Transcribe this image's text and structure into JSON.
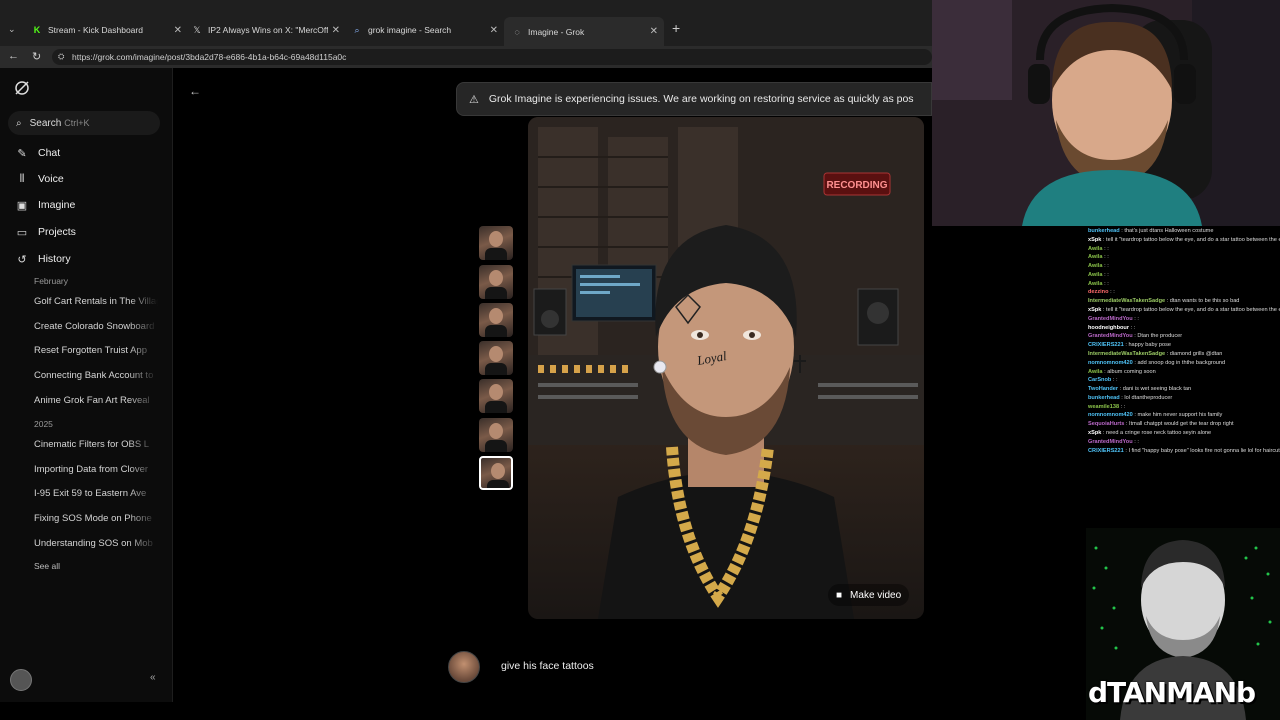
{
  "browser": {
    "tabs": [
      {
        "title": "Stream - Kick Dashboard",
        "icon": "kick-icon"
      },
      {
        "title": "IP2 Always Wins on X: \"MercOffDa",
        "icon": "x-logo-icon"
      },
      {
        "title": "grok imagine - Search",
        "icon": "search-icon"
      },
      {
        "title": "Imagine - Grok",
        "icon": "grok-icon"
      }
    ],
    "url": "https://grok.com/imagine/post/3bda2d78-e686-4b1a-b64c-69a48d115a0c"
  },
  "sidebar": {
    "search_label": "Search",
    "search_shortcut": "Ctrl+K",
    "nav": [
      {
        "label": "Chat",
        "icon": "chat-icon"
      },
      {
        "label": "Voice",
        "icon": "voice-icon"
      },
      {
        "label": "Imagine",
        "icon": "imagine-icon"
      },
      {
        "label": "Projects",
        "icon": "projects-icon"
      },
      {
        "label": "History",
        "icon": "history-icon"
      }
    ],
    "history_groups": [
      {
        "label": "February",
        "items": [
          "Golf Cart Rentals in The Villages",
          "Create Colorado Snowboard",
          "Reset Forgotten Truist App",
          "Connecting Bank Account to",
          "Anime Grok Fan Art Reveal"
        ]
      },
      {
        "label": "2025",
        "items": [
          "Cinematic Filters for OBS L",
          "Importing Data from Clover",
          "I-95 Exit 59 to Eastern Ave",
          "Fixing SOS Mode on Phone",
          "Understanding SOS on Mob"
        ]
      }
    ],
    "see_all": "See all"
  },
  "banner": {
    "text": "Grok Imagine is experiencing issues. We are working on restoring service as quickly as pos"
  },
  "image": {
    "sign_text": "RECORDING",
    "tattoo_text": "Loyal"
  },
  "make_video_label": "Make video",
  "prompt": {
    "text": "give his face tattoos"
  },
  "chat_messages": [
    {
      "user": "bunkerhead",
      "color": "#4fc3f7",
      "text": "that's just dtans Halloween costume"
    },
    {
      "user": "xSpk",
      "color": "#ffffff",
      "text": "tell it \"teardrop tattoo below the eye, and do a star tattoo between the eyebrows\""
    },
    {
      "user": "Awila",
      "color": "#8bc34a",
      "text": ":"
    },
    {
      "user": "Awila",
      "color": "#8bc34a",
      "text": ":"
    },
    {
      "user": "Awila",
      "color": "#8bc34a",
      "text": ":"
    },
    {
      "user": "Awila",
      "color": "#8bc34a",
      "text": ":"
    },
    {
      "user": "Awila",
      "color": "#8bc34a",
      "text": ":"
    },
    {
      "user": "dezzino",
      "color": "#ff6b6b",
      "text": ":"
    },
    {
      "user": "IntermediateWasTakenSadge",
      "color": "#9ccc65",
      "text": "dtan wants to be this so bad"
    },
    {
      "user": "xSpk",
      "color": "#ffffff",
      "text": "tell it \"teardrop tattoo below the eye, and do a star tattoo between the eyebrows\""
    },
    {
      "user": "GrantedMindYou",
      "color": "#ba68c8",
      "text": ":"
    },
    {
      "user": "hoodneighbour",
      "color": "#ffffff",
      "text": ":"
    },
    {
      "user": "GrantedMindYou",
      "color": "#ba68c8",
      "text": "Dtan the producer"
    },
    {
      "user": "CRIXIERS221",
      "color": "#4fc3f7",
      "text": "happy baby pose"
    },
    {
      "user": "IntermediateWasTakenSadge",
      "color": "#9ccc65",
      "text": "diamond grills @dtan"
    },
    {
      "user": "nomnomnom420",
      "color": "#4fc3f7",
      "text": "add snoop dog in ththe background"
    },
    {
      "user": "Awila",
      "color": "#8bc34a",
      "text": "album coming soon"
    },
    {
      "user": "CarSnob",
      "color": "#4fc3f7",
      "text": ":"
    },
    {
      "user": "TwoHander",
      "color": "#4fc3f7",
      "text": "dani is wet seeing black tan"
    },
    {
      "user": "bunkerhead",
      "color": "#4fc3f7",
      "text": "lol dtantheproducer"
    },
    {
      "user": "weamile138",
      "color": "#8bc34a",
      "text": ":"
    },
    {
      "user": "nomnomnom420",
      "color": "#4fc3f7",
      "text": "make him never support his family"
    },
    {
      "user": "SequoiaHurts",
      "color": "#ba68c8",
      "text": "Itmall chatgpt would get the tear drop right"
    },
    {
      "user": "xSpk",
      "color": "#ffffff",
      "text": "need a cringe rose neck tattoo seyin alone"
    },
    {
      "user": "GrantedMindYou",
      "color": "#ba68c8",
      "text": ":"
    },
    {
      "user": "CRIXIERS221",
      "color": "#4fc3f7",
      "text": "I find \"happy baby pose\" looks fire not gonna lie lol for haircut"
    }
  ],
  "overlay": {
    "brand_text": "dTANMANb"
  }
}
